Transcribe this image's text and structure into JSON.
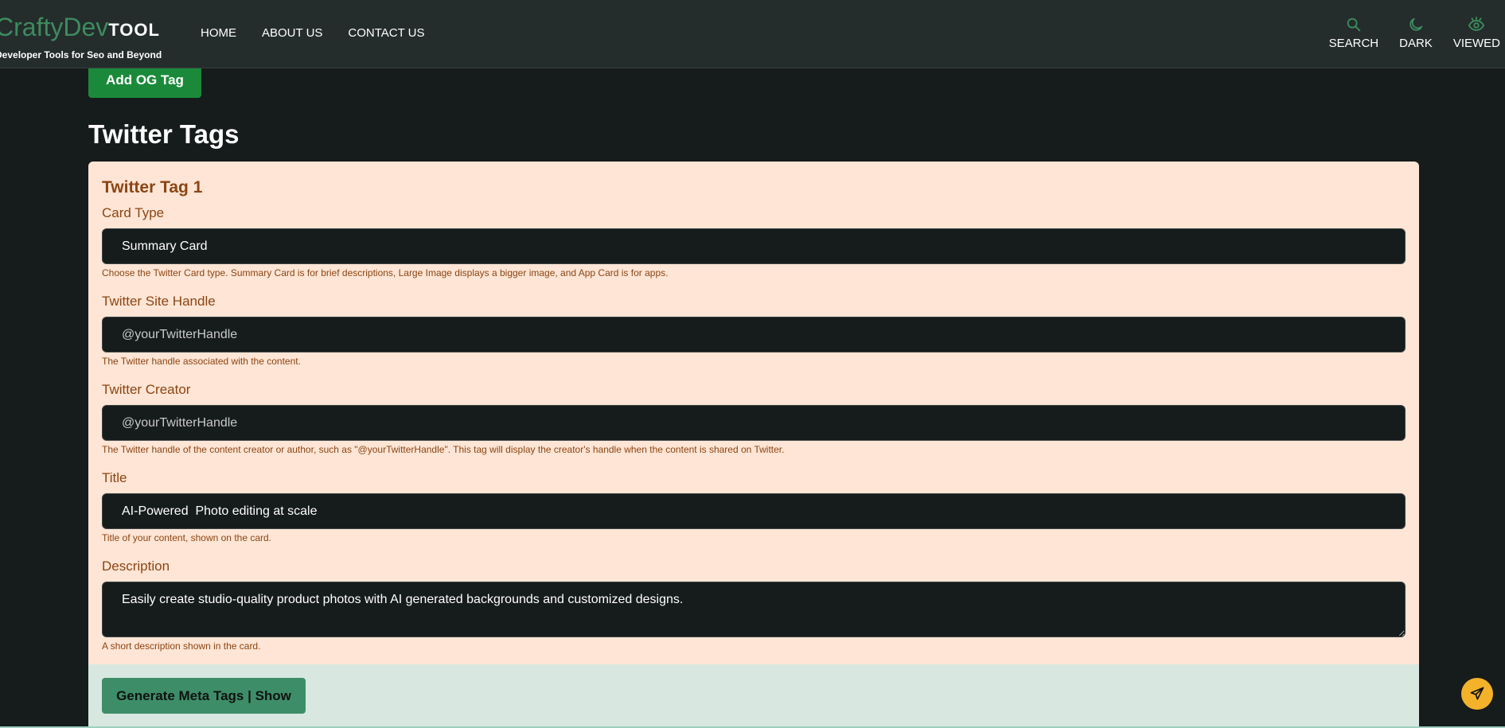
{
  "brand": {
    "name_part1": "CraftyDev",
    "name_part2": "TOOL",
    "tagline": "Developer Tools for Seo and Beyond",
    "primary_color": "#3c8c5e"
  },
  "nav": {
    "links": [
      "HOME",
      "ABOUT US",
      "CONTACT US"
    ],
    "tools": [
      {
        "label": "SEARCH",
        "icon": "search-icon"
      },
      {
        "label": "DARK",
        "icon": "moon-icon"
      },
      {
        "label": "VIEWED",
        "icon": "eye-icon"
      }
    ]
  },
  "og": {
    "add_button_label": "Add OG Tag"
  },
  "twitter": {
    "section_title": "Twitter Tags",
    "card_title": "Twitter Tag 1",
    "fields": {
      "card_type": {
        "label": "Card Type",
        "value": "Summary Card",
        "help": "Choose the Twitter Card type. Summary Card is for brief descriptions, Large Image displays a bigger image, and App Card is for apps."
      },
      "site_handle": {
        "label": "Twitter Site Handle",
        "value": "",
        "placeholder": "@yourTwitterHandle",
        "help": "The Twitter handle associated with the content."
      },
      "creator": {
        "label": "Twitter Creator",
        "value": "",
        "placeholder": "@yourTwitterHandle",
        "help": "The Twitter handle of the content creator or author, such as \"@yourTwitterHandle\". This tag will display the creator's handle when the content is shared on Twitter."
      },
      "title": {
        "label": "Title",
        "value": "AI-Powered  Photo editing at scale",
        "help": "Title of your content, shown on the card."
      },
      "description": {
        "label": "Description",
        "value": "Easily create studio-quality product photos with AI generated backgrounds and customized designs.",
        "help": "A short description shown in the card."
      }
    }
  },
  "actions": {
    "generate_label": "Generate Meta Tags | Show",
    "fab_icon": "send-icon",
    "fab_color": "#f4b22a"
  }
}
